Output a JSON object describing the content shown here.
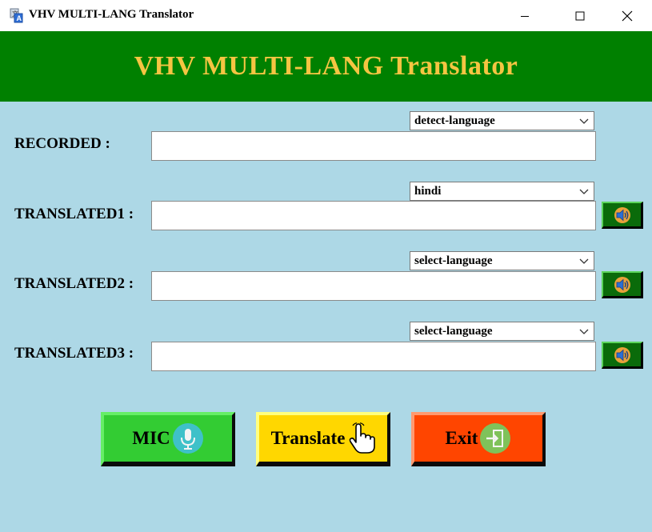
{
  "window": {
    "title": "VHV MULTI-LANG Translator",
    "icon": "translator-app-icon",
    "controls": [
      "minimize-icon",
      "maximize-icon",
      "close-icon"
    ]
  },
  "header": {
    "title": "VHV MULTI-LANG Translator"
  },
  "colors": {
    "background": "#add8e6",
    "header_bg": "#008000",
    "header_text": "#f5c542",
    "mic_button": "#33cc33",
    "translate_button": "#ffd700",
    "exit_button": "#ff4500",
    "speaker_button": "#0a6b0a"
  },
  "rows": [
    {
      "label": "RECORDED :",
      "language": "detect-language",
      "text": "",
      "speaker": false
    },
    {
      "label": "TRANSLATED1 :",
      "language": "hindi",
      "text": "",
      "speaker": true
    },
    {
      "label": "TRANSLATED2 :",
      "language": "select-language",
      "text": "",
      "speaker": true
    },
    {
      "label": "TRANSLATED3 :",
      "language": "select-language",
      "text": "",
      "speaker": true
    }
  ],
  "buttons": {
    "mic": {
      "label": "MIC",
      "icon": "microphone-icon"
    },
    "translate": {
      "label": "Translate",
      "icon": "hand-pointer-icon"
    },
    "exit": {
      "label": "Exit",
      "icon": "exit-door-icon"
    }
  }
}
